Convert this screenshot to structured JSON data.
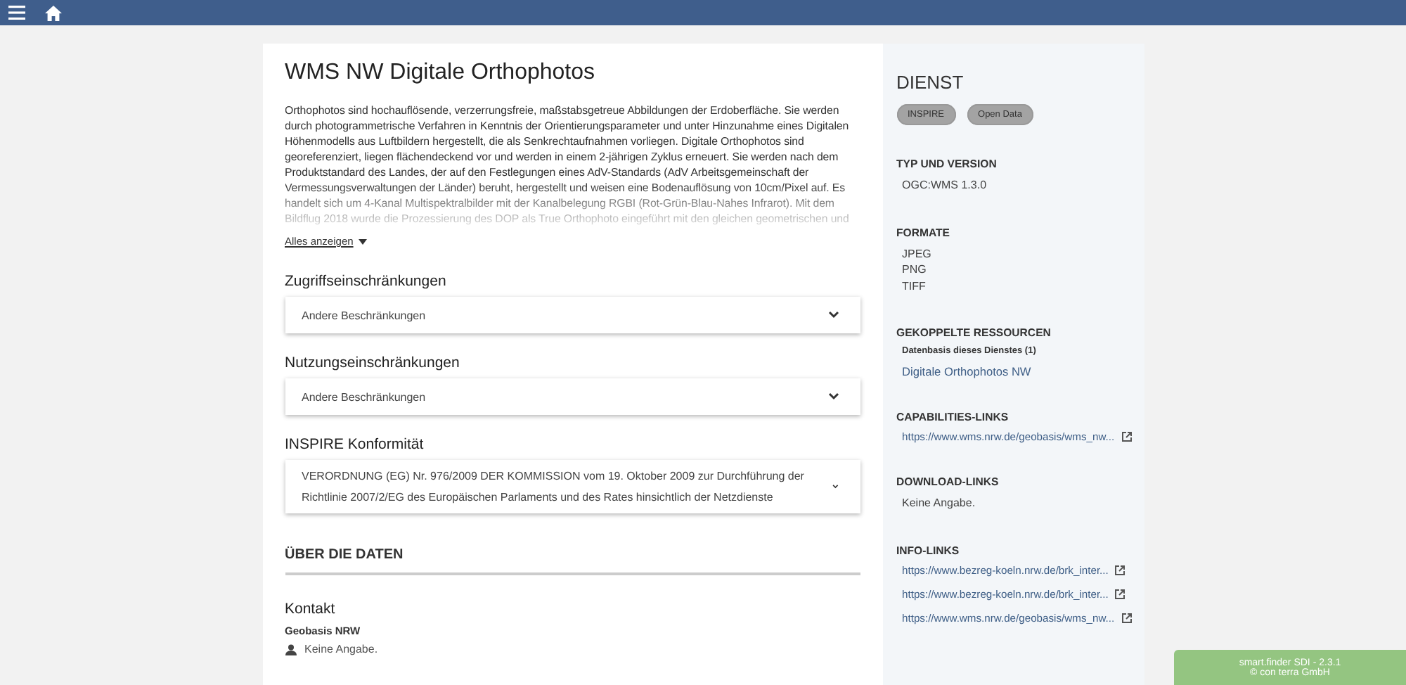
{
  "title": "WMS NW Digitale Orthophotos",
  "description": "Orthophotos sind hochauflösende, verzerrungsfreie, maßstabsgetreue Abbildungen der Erdoberfläche. Sie werden durch photogrammetrische Verfahren in Kenntnis der Orientierungsparameter und unter Hinzunahme eines Digitalen Höhenmodells aus Luftbildern hergestellt, die als Senkrechtaufnahmen vorliegen. Digitale Orthophotos sind georeferenziert, liegen flächendeckend vor und werden in einem 2-jährigen Zyklus erneuert. Sie werden nach dem Produktstandard des Landes, der auf den Festlegungen eines AdV-Standards (AdV Arbeitsgemeinschaft der Vermessungsverwaltungen der Länder) beruht, hergestellt und weisen eine Bodenauflösung von 10cm/Pixel auf. Es handelt sich um 4-Kanal Multispektralbilder mit der Kanalbelegung RGBI (Rot-Grün-Blau-Nahes Infrarot). Mit dem Bildflug 2018 wurde die Prozessierung des DOP als True Orthophoto eingeführt mit den gleichen geometrischen und",
  "show_all": "Alles anzeigen",
  "sections": [
    {
      "heading": "Zugriffseinschränkungen",
      "value": "Andere Beschränkungen",
      "expanded": false
    },
    {
      "heading": "Nutzungseinschränkungen",
      "value": "Andere Beschränkungen",
      "expanded": false
    },
    {
      "heading": "INSPIRE Konformität",
      "value": "VERORDNUNG (EG) Nr. 976/2009 DER KOMMISSION vom 19. Oktober 2009 zur Durchführung der Richtlinie 2007/2/EG des Europäischen Parlaments und des Rates hinsichtlich der Netzdienste",
      "expanded": false
    }
  ],
  "about_heading": "ÜBER DIE DATEN",
  "contact": {
    "heading": "Kontakt",
    "organisation": "Geobasis NRW",
    "person": "Keine Angabe."
  },
  "sidebar": {
    "title": "DIENST",
    "tags": [
      "INSPIRE",
      "Open Data"
    ],
    "groups": [
      {
        "kind": "text",
        "heading": "TYP UND VERSION",
        "items": [
          "OGC:WMS 1.3.0"
        ]
      },
      {
        "kind": "text",
        "heading": "FORMATE",
        "items": [
          "JPEG",
          "PNG",
          "TIFF"
        ]
      },
      {
        "kind": "coupled",
        "heading": "GEKOPPELTE RESSOURCEN",
        "subheading": "Datenbasis dieses Dienstes (1)",
        "items": [
          "Digitale Orthophotos NW"
        ]
      },
      {
        "kind": "links",
        "heading": "CAPABILITIES-LINKS",
        "items": [
          "https://www.wms.nrw.de/geobasis/wms_nw..."
        ]
      },
      {
        "kind": "text",
        "heading": "DOWNLOAD-LINKS",
        "items": [
          "Keine Angabe."
        ]
      },
      {
        "kind": "links",
        "heading": "INFO-LINKS",
        "items": [
          "https://www.bezreg-koeln.nrw.de/brk_inter...",
          "https://www.bezreg-koeln.nrw.de/brk_inter...",
          "https://www.wms.nrw.de/geobasis/wms_nw..."
        ]
      }
    ]
  },
  "footer": [
    "smart.finder SDI - 2.3.1",
    "© con terra GmbH"
  ]
}
